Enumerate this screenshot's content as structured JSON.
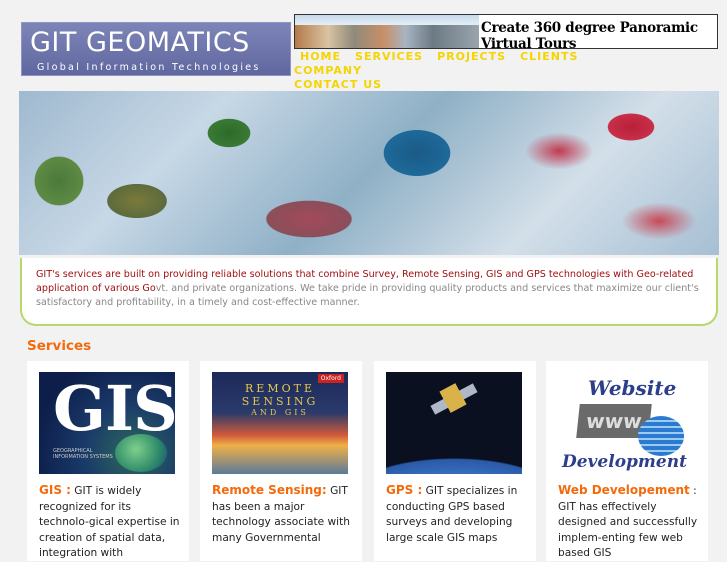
{
  "logo": {
    "title": "GIT GEOMATICS",
    "subtitle": "Global Information Technologies"
  },
  "banner": {
    "text": "Create 360 degree Panoramic Virtual Tours"
  },
  "nav": {
    "items": [
      "HOME",
      "SERVICES",
      "PROJECTS",
      "CLIENTS",
      "COMPANY",
      "CONTACT US"
    ]
  },
  "intro": {
    "lead": "GIT's services are built on providing reliable solutions that combine Survey, Remote Sensing, GIS and GPS technologies with Geo-related application of various Go",
    "rest": "vt. and private organizations. We take pride in providing quality products and services that maximize our client's satisfactory and profitability, in a timely and cost-effective manner."
  },
  "services": {
    "heading": "Services",
    "cards": [
      {
        "head": "GIS :",
        "text": " GIT is widely recognized for its technolo-gical expertise in creation of spatial data, integration with",
        "image": {
          "big": "GIS",
          "small": "GEOGRAPHICAL INFORMATION SYSTEMS"
        }
      },
      {
        "head": "Remote Sensing:",
        "text": " GIT has been a major technology associate with many Governmental",
        "image": {
          "line1": "REMOTE",
          "line2": "SENSING",
          "line3": "AND GIS",
          "badge": "Oxford"
        }
      },
      {
        "head": "GPS :",
        "text": " GIT specializes in conducting GPS based surveys and developing large scale GIS maps",
        "image": {}
      },
      {
        "head": "Web Developement",
        "text": " : GIT has effectively designed and successfully implem-enting few web based GIS",
        "image": {
          "top": "Website",
          "mid": "www",
          "bottom": "Development"
        }
      }
    ]
  }
}
